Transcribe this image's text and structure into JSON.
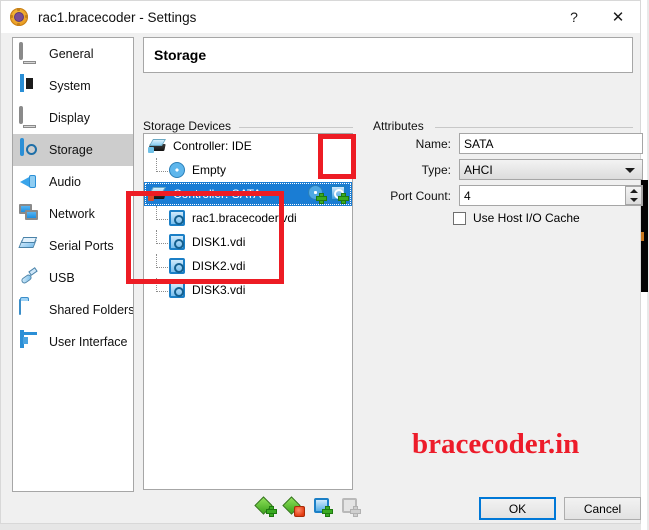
{
  "window": {
    "title": "rac1.bracecoder - Settings",
    "app_icon": "virtualbox-icon",
    "help_button": "?",
    "close_button": "✕"
  },
  "sidebar": {
    "items": [
      {
        "label": "General",
        "icon": "monitor-icon",
        "selected": false
      },
      {
        "label": "System",
        "icon": "chip-icon",
        "selected": false
      },
      {
        "label": "Display",
        "icon": "display-icon",
        "selected": false
      },
      {
        "label": "Storage",
        "icon": "disk-icon",
        "selected": true
      },
      {
        "label": "Audio",
        "icon": "speaker-icon",
        "selected": false
      },
      {
        "label": "Network",
        "icon": "network-icon",
        "selected": false
      },
      {
        "label": "Serial Ports",
        "icon": "serial-port-icon",
        "selected": false
      },
      {
        "label": "USB",
        "icon": "usb-icon",
        "selected": false
      },
      {
        "label": "Shared Folders",
        "icon": "folder-icon",
        "selected": false
      },
      {
        "label": "User Interface",
        "icon": "window-icon",
        "selected": false
      }
    ]
  },
  "pane": {
    "title": "Storage"
  },
  "storage_devices": {
    "group_title": "Storage Devices",
    "tree": [
      {
        "label": "Controller: IDE",
        "icon": "ide-controller-icon",
        "depth": 0,
        "selected": false
      },
      {
        "label": "Empty",
        "icon": "cd-empty-icon",
        "depth": 1,
        "selected": false
      },
      {
        "label": "Controller: SATA",
        "icon": "sata-controller-icon",
        "depth": 0,
        "selected": true
      },
      {
        "label": "rac1.bracecoder.vdi",
        "icon": "hard-disk-icon",
        "depth": 1,
        "selected": false
      },
      {
        "label": "DISK1.vdi",
        "icon": "hard-disk-icon",
        "depth": 1,
        "selected": false
      },
      {
        "label": "DISK2.vdi",
        "icon": "hard-disk-icon",
        "depth": 1,
        "selected": false
      },
      {
        "label": "DISK3.vdi",
        "icon": "hard-disk-icon",
        "depth": 1,
        "selected": false
      }
    ],
    "row_actions": [
      {
        "name": "add-optical-drive-icon"
      },
      {
        "name": "add-hard-disk-icon"
      }
    ],
    "toolbar": [
      {
        "name": "add-controller-icon",
        "enabled": true
      },
      {
        "name": "remove-controller-icon",
        "enabled": true
      },
      {
        "name": "add-attachment-icon",
        "enabled": true
      },
      {
        "name": "remove-attachment-icon",
        "enabled": false
      }
    ]
  },
  "attributes": {
    "group_title": "Attributes",
    "name_label": "Name:",
    "name_value": "SATA",
    "type_label": "Type:",
    "type_value": "AHCI",
    "port_count_label": "Port Count:",
    "port_count_value": "4",
    "host_io_cache_label": "Use Host I/O Cache",
    "host_io_cache_checked": false
  },
  "footer": {
    "ok_label": "OK",
    "cancel_label": "Cancel"
  },
  "watermark": {
    "text": "bracecoder.in",
    "color": "#ed1c2a"
  },
  "annotations": {
    "accent_color": "#ed1c24",
    "boxes": [
      {
        "name": "add-hard-disk-highlight"
      },
      {
        "name": "disks-highlight"
      }
    ]
  }
}
